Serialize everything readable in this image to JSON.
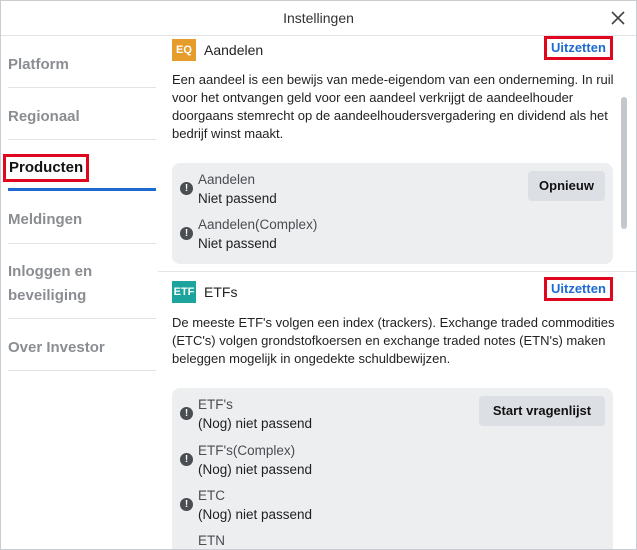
{
  "dialog": {
    "title": "Instellingen"
  },
  "sidebar": {
    "items": [
      {
        "label": "Platform"
      },
      {
        "label": "Regionaal"
      },
      {
        "label": "Producten"
      },
      {
        "label": "Meldingen"
      },
      {
        "label": "Inloggen en beveiliging"
      },
      {
        "label": "Over Investor"
      }
    ],
    "active_index": 2
  },
  "sections": [
    {
      "badge": "EQ",
      "badge_color": "#e59c2a",
      "title": "Aandelen",
      "action": "Uitzetten",
      "description": "Een aandeel is een bewijs van mede-eigendom van een onderneming. In ruil voor het ontvangen geld voor een aandeel verkrijgt de aandeelhouder doorgaans stemrecht op de aandeelhoudersvergadering en dividend als het bedrijf winst maakt.",
      "button": "Opnieuw",
      "items": [
        {
          "name": "Aandelen",
          "status": "Niet passend"
        },
        {
          "name": "Aandelen(Complex)",
          "status": "Niet passend"
        }
      ]
    },
    {
      "badge": "ETF",
      "badge_color": "#1ba39c",
      "title": "ETFs",
      "action": "Uitzetten",
      "description": "De meeste ETF's volgen een index (trackers). Exchange traded commodities (ETC's) volgen grondstofkoersen en exchange traded notes (ETN's) maken beleggen mogelijk in ongedekte schuldbewijzen.",
      "button": "Start vragenlijst",
      "items": [
        {
          "name": "ETF's",
          "status": "(Nog) niet passend"
        },
        {
          "name": "ETF's(Complex)",
          "status": "(Nog) niet passend"
        },
        {
          "name": "ETC",
          "status": "(Nog) niet passend"
        },
        {
          "name": "ETN",
          "status": ""
        }
      ]
    }
  ],
  "colors": {
    "accent": "#1e69d2",
    "highlight": "#e0061f"
  }
}
